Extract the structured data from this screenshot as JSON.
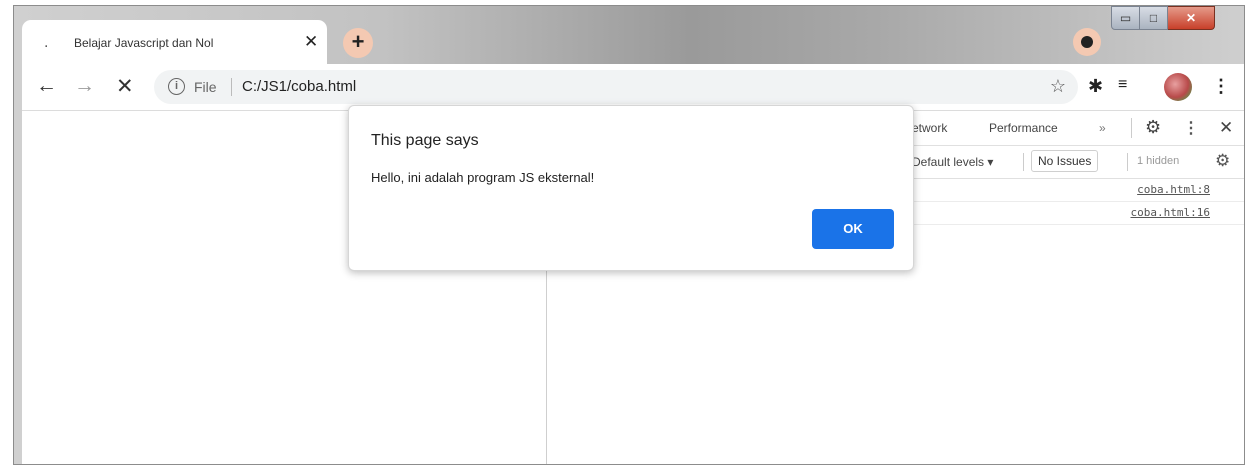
{
  "browser": {
    "tab": {
      "title": "Belajar Javascript dan Nol",
      "close": "✕"
    },
    "new_tab": "+",
    "window_controls": {
      "minimize": "▭",
      "maximize": "□",
      "close": "✕"
    },
    "toolbar": {
      "back": "←",
      "forward": "→",
      "stop": "✕",
      "address": {
        "scheme": "File",
        "url": "C:/JS1/coba.html"
      }
    }
  },
  "devtools": {
    "tabs": [
      "etwork",
      "Performance",
      "»"
    ],
    "console": {
      "levels": "Default levels ▾",
      "issues": "No Issues",
      "hidden": "1 hidden",
      "rows": [
        {
          "source": "coba.html:8"
        },
        {
          "source": "coba.html:16"
        }
      ]
    }
  },
  "dialog": {
    "title": "This page says",
    "message": "Hello, ini adalah program JS eksternal!",
    "ok_label": "OK"
  },
  "colors": {
    "ok_button": "#1a73e8",
    "accent_peach": "#f4c9b2"
  },
  "icons": [
    "info-icon",
    "star-icon",
    "puzzle-icon",
    "media-queue-icon",
    "avatar",
    "kebab-icon",
    "gear-icon",
    "close-icon"
  ]
}
